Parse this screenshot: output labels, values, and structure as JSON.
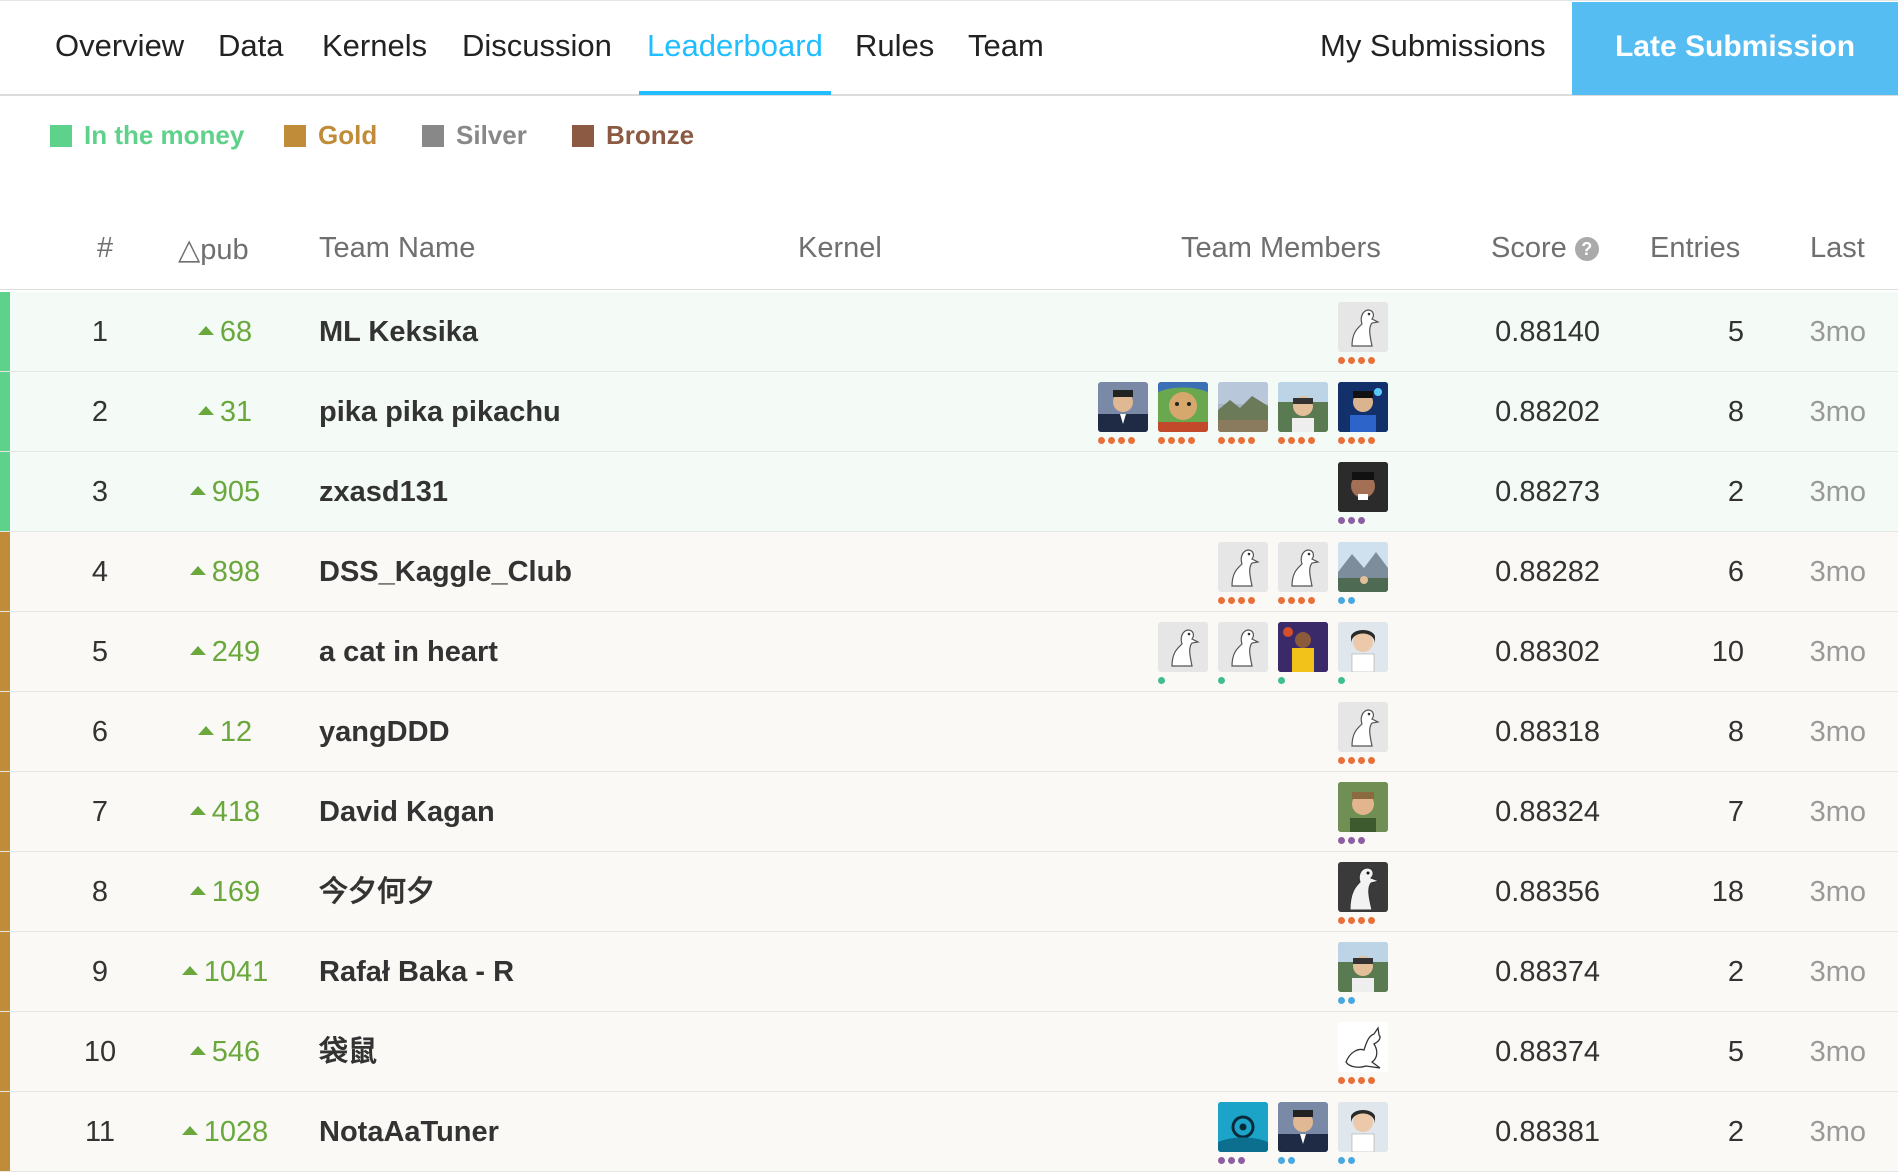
{
  "colors": {
    "accent": "#20beff",
    "late_button": "#56bdf2",
    "in_the_money": "#5ed28a",
    "gold": "#c18c3a",
    "silver": "#888888",
    "bronze": "#8c5a43",
    "delta_green": "#6aa83d",
    "row_money_bg": "#f4fbf6",
    "row_gold_bg": "#faf9f5"
  },
  "nav": {
    "tabs": [
      {
        "label": "Overview"
      },
      {
        "label": "Data"
      },
      {
        "label": "Kernels"
      },
      {
        "label": "Discussion"
      },
      {
        "label": "Leaderboard",
        "active": true
      },
      {
        "label": "Rules"
      },
      {
        "label": "Team"
      }
    ],
    "my_submissions": "My Submissions",
    "late_submission": "Late Submission"
  },
  "legend": [
    {
      "label": "In the money",
      "color": "#5ed28a"
    },
    {
      "label": "Gold",
      "color": "#c18c3a"
    },
    {
      "label": "Silver",
      "color": "#888888"
    },
    {
      "label": "Bronze",
      "color": "#8c5a43"
    }
  ],
  "table": {
    "headers": {
      "rank": "#",
      "delta": "△pub",
      "team_name": "Team Name",
      "kernel": "Kernel",
      "team_members": "Team Members",
      "score": "Score",
      "entries": "Entries",
      "last": "Last"
    },
    "rows": [
      {
        "rank": "1",
        "delta": "68",
        "team": "ML Keksika",
        "score": "0.88140",
        "entries": "5",
        "last": "3mo",
        "tier": "money",
        "members": [
          {
            "avatar": "goose",
            "dots": 4,
            "dot_color": "#e8703a"
          }
        ]
      },
      {
        "rank": "2",
        "delta": "31",
        "team": "pika pika pikachu",
        "score": "0.88202",
        "entries": "8",
        "last": "3mo",
        "tier": "money",
        "members": [
          {
            "avatar": "person-suit",
            "dots": 4,
            "dot_color": "#e8703a"
          },
          {
            "avatar": "person-art",
            "dots": 4,
            "dot_color": "#e8703a"
          },
          {
            "avatar": "landscape",
            "dots": 4,
            "dot_color": "#e8703a"
          },
          {
            "avatar": "person-outdoor",
            "dots": 4,
            "dot_color": "#e8703a"
          },
          {
            "avatar": "person-blue",
            "dots": 4,
            "dot_color": "#e8703a"
          }
        ]
      },
      {
        "rank": "3",
        "delta": "905",
        "team": "zxasd131",
        "score": "0.88273",
        "entries": "2",
        "last": "3mo",
        "tier": "money",
        "members": [
          {
            "avatar": "person-dark",
            "dots": 3,
            "dot_color": "#8e5ea2"
          }
        ]
      },
      {
        "rank": "4",
        "delta": "898",
        "team": "DSS_Kaggle_Club",
        "score": "0.88282",
        "entries": "6",
        "last": "3mo",
        "tier": "gold",
        "members": [
          {
            "avatar": "goose",
            "dots": 4,
            "dot_color": "#e8703a"
          },
          {
            "avatar": "goose",
            "dots": 4,
            "dot_color": "#e8703a"
          },
          {
            "avatar": "mountain",
            "dots": 2,
            "dot_color": "#4aa8e0"
          }
        ]
      },
      {
        "rank": "5",
        "delta": "249",
        "team": "a cat in heart",
        "score": "0.88302",
        "entries": "10",
        "last": "3mo",
        "tier": "gold",
        "members": [
          {
            "avatar": "goose",
            "dots": 1,
            "dot_color": "#3fbf8f"
          },
          {
            "avatar": "goose",
            "dots": 1,
            "dot_color": "#3fbf8f"
          },
          {
            "avatar": "sports",
            "dots": 1,
            "dot_color": "#3fbf8f"
          },
          {
            "avatar": "person-light",
            "dots": 1,
            "dot_color": "#3fbf8f"
          }
        ]
      },
      {
        "rank": "6",
        "delta": "12",
        "team": "yangDDD",
        "score": "0.88318",
        "entries": "8",
        "last": "3mo",
        "tier": "gold",
        "members": [
          {
            "avatar": "goose",
            "dots": 4,
            "dot_color": "#e8703a"
          }
        ]
      },
      {
        "rank": "7",
        "delta": "418",
        "team": "David Kagan",
        "score": "0.88324",
        "entries": "7",
        "last": "3mo",
        "tier": "gold",
        "members": [
          {
            "avatar": "person-green",
            "dots": 3,
            "dot_color": "#8e5ea2"
          }
        ]
      },
      {
        "rank": "8",
        "delta": "169",
        "team": "今夕何夕",
        "score": "0.88356",
        "entries": "18",
        "last": "3mo",
        "tier": "gold",
        "members": [
          {
            "avatar": "goose-dark",
            "dots": 4,
            "dot_color": "#e8703a"
          }
        ]
      },
      {
        "rank": "9",
        "delta": "1041",
        "team": "Rafał Baka - R",
        "score": "0.88374",
        "entries": "2",
        "last": "3mo",
        "tier": "gold",
        "members": [
          {
            "avatar": "person-outdoor",
            "dots": 2,
            "dot_color": "#4aa8e0"
          }
        ]
      },
      {
        "rank": "10",
        "delta": "546",
        "team": "袋鼠",
        "score": "0.88374",
        "entries": "5",
        "last": "3mo",
        "tier": "gold",
        "members": [
          {
            "avatar": "kangaroo",
            "dots": 4,
            "dot_color": "#e8703a"
          }
        ]
      },
      {
        "rank": "11",
        "delta": "1028",
        "team": "NotaAaTuner",
        "score": "0.88381",
        "entries": "2",
        "last": "3mo",
        "tier": "gold",
        "members": [
          {
            "avatar": "blue-eye",
            "dots": 3,
            "dot_color": "#8e5ea2"
          },
          {
            "avatar": "person-suit",
            "dots": 2,
            "dot_color": "#4aa8e0"
          },
          {
            "avatar": "person-light",
            "dots": 2,
            "dot_color": "#4aa8e0"
          }
        ]
      }
    ]
  }
}
